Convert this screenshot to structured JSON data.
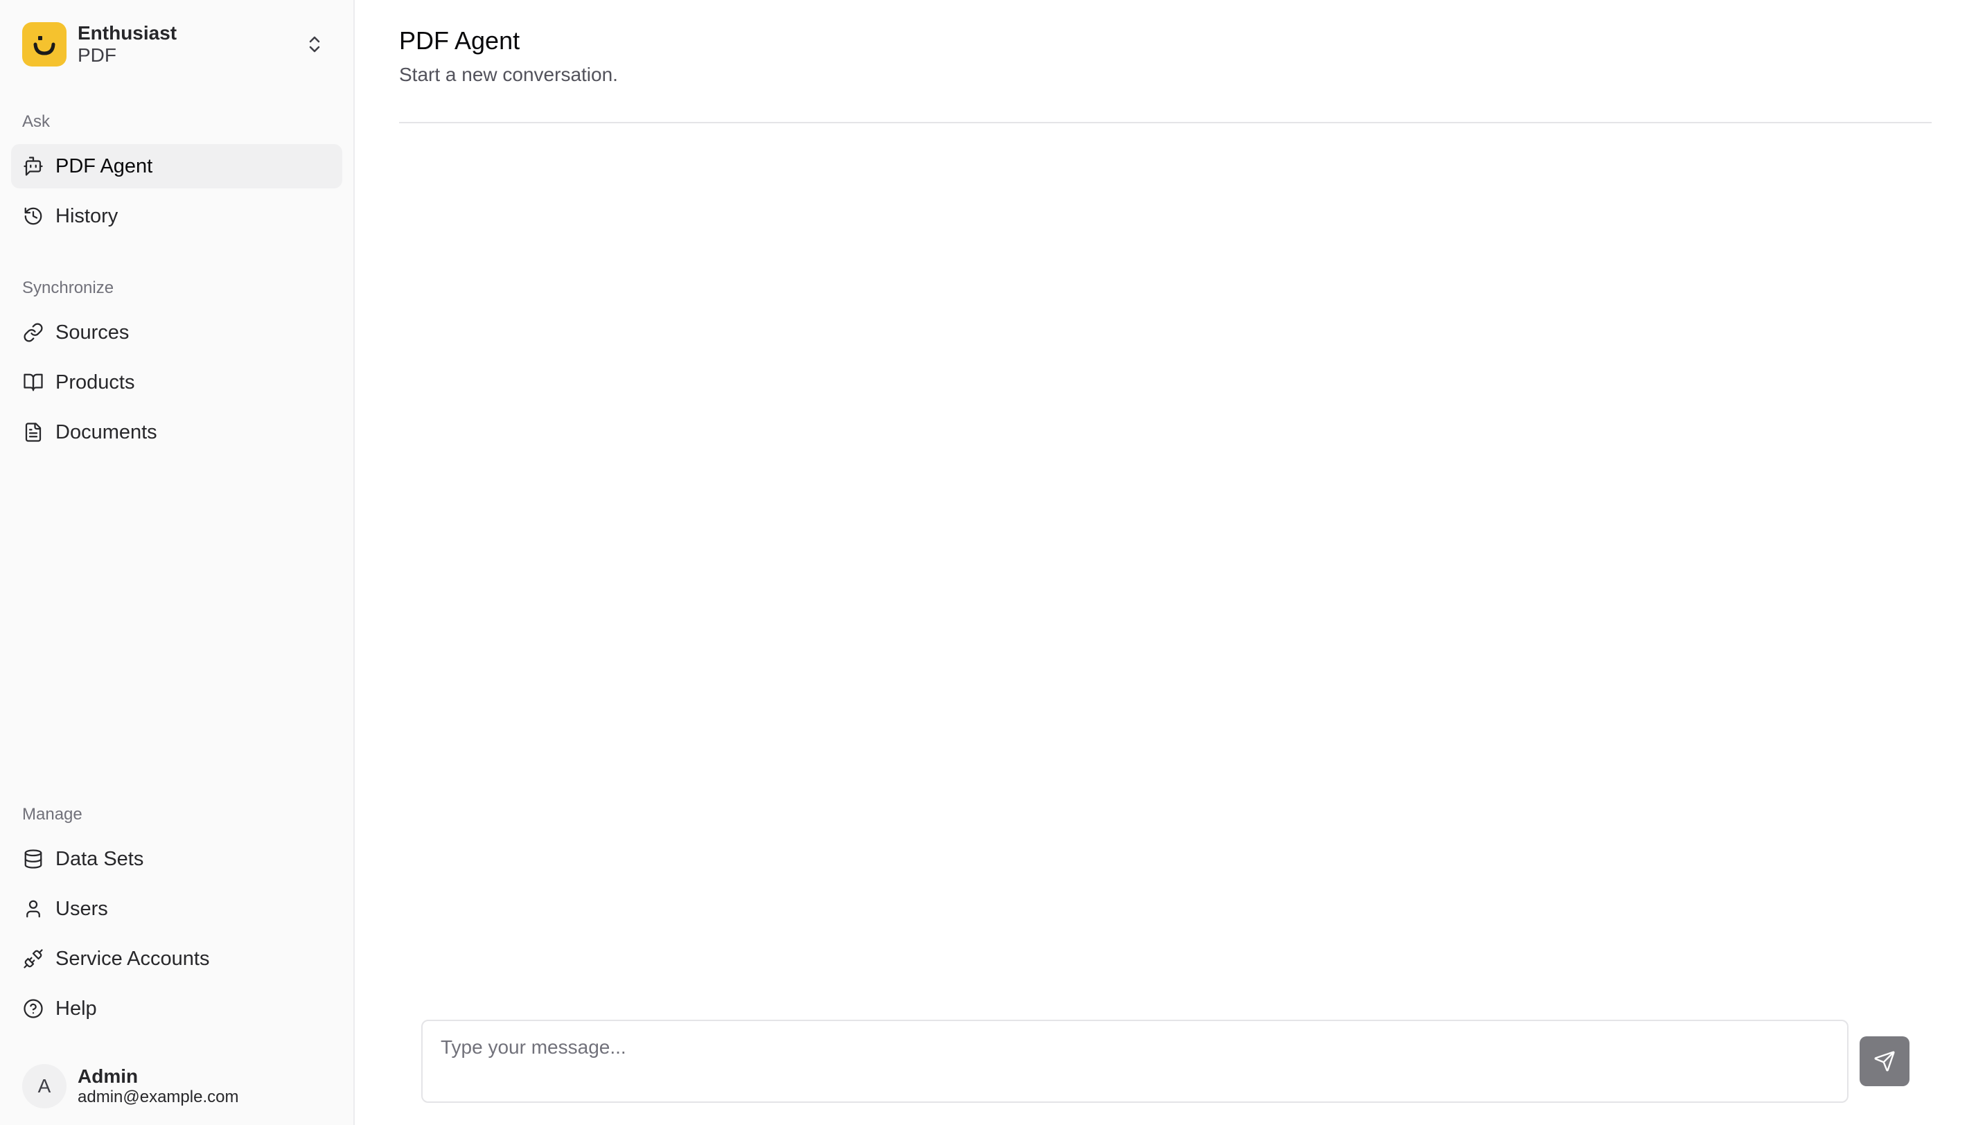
{
  "brand": {
    "name": "Enthusiast",
    "subtitle": "PDF",
    "logo_color": "#f5c22e"
  },
  "sidebar": {
    "groups": [
      {
        "label": "Ask",
        "items": [
          {
            "label": "PDF Agent",
            "icon": "bot-message-icon",
            "active": true
          },
          {
            "label": "History",
            "icon": "history-icon",
            "active": false
          }
        ]
      },
      {
        "label": "Synchronize",
        "items": [
          {
            "label": "Sources",
            "icon": "link-icon"
          },
          {
            "label": "Products",
            "icon": "book-open-icon"
          },
          {
            "label": "Documents",
            "icon": "file-text-icon"
          }
        ]
      },
      {
        "label": "Manage",
        "items": [
          {
            "label": "Data Sets",
            "icon": "database-icon"
          },
          {
            "label": "Users",
            "icon": "user-icon"
          },
          {
            "label": "Service Accounts",
            "icon": "plug-icon"
          },
          {
            "label": "Help",
            "icon": "help-circle-icon"
          }
        ]
      }
    ]
  },
  "user": {
    "initial": "A",
    "name": "Admin",
    "email": "admin@example.com"
  },
  "main": {
    "title": "PDF Agent",
    "subtitle": "Start a new conversation."
  },
  "composer": {
    "placeholder": "Type your message...",
    "send_button_color": "#7a7a7f"
  }
}
